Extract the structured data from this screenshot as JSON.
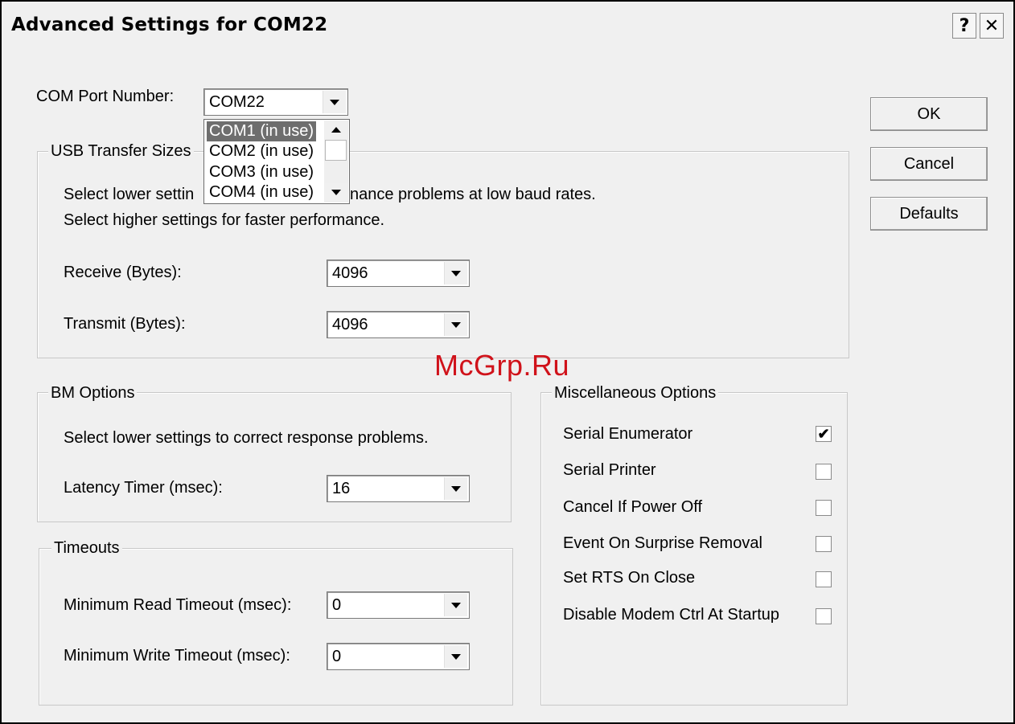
{
  "window": {
    "title": "Advanced Settings for COM22",
    "help_label": "?",
    "close_label": "✕"
  },
  "com_port": {
    "label": "COM Port Number:",
    "value": "COM22",
    "options_visible": [
      "COM1 (in use)",
      "COM2 (in use)",
      "COM3 (in use)",
      "COM4 (in use)"
    ],
    "highlighted_index": 0
  },
  "usb_transfer": {
    "legend": "USB Transfer Sizes",
    "desc1": "Select lower settings to correct performance problems at low baud rates.",
    "desc1_visible_left": "Select lower settin",
    "desc1_visible_right": "nance problems at low baud rates.",
    "desc2": "Select higher settings for faster performance.",
    "receive_label": "Receive (Bytes):",
    "receive_value": "4096",
    "transmit_label": "Transmit (Bytes):",
    "transmit_value": "4096"
  },
  "bm_options": {
    "legend": "BM Options",
    "desc": "Select lower settings to correct response problems.",
    "latency_label": "Latency Timer (msec):",
    "latency_value": "16"
  },
  "timeouts": {
    "legend": "Timeouts",
    "read_label": "Minimum Read Timeout (msec):",
    "read_value": "0",
    "write_label": "Minimum Write Timeout (msec):",
    "write_value": "0"
  },
  "misc": {
    "legend": "Miscellaneous Options",
    "items": [
      {
        "label": "Serial Enumerator",
        "checked": true
      },
      {
        "label": "Serial Printer",
        "checked": false
      },
      {
        "label": "Cancel If Power Off",
        "checked": false
      },
      {
        "label": "Event On Surprise Removal",
        "checked": false
      },
      {
        "label": "Set RTS On Close",
        "checked": false
      },
      {
        "label": "Disable Modem Ctrl At Startup",
        "checked": false
      }
    ],
    "check_glyph": "✔"
  },
  "buttons": {
    "ok": "OK",
    "cancel": "Cancel",
    "defaults": "Defaults"
  },
  "watermark": "McGrp.Ru",
  "colors": {
    "watermark": "#d0121a",
    "highlight": "#6e6e6e"
  }
}
